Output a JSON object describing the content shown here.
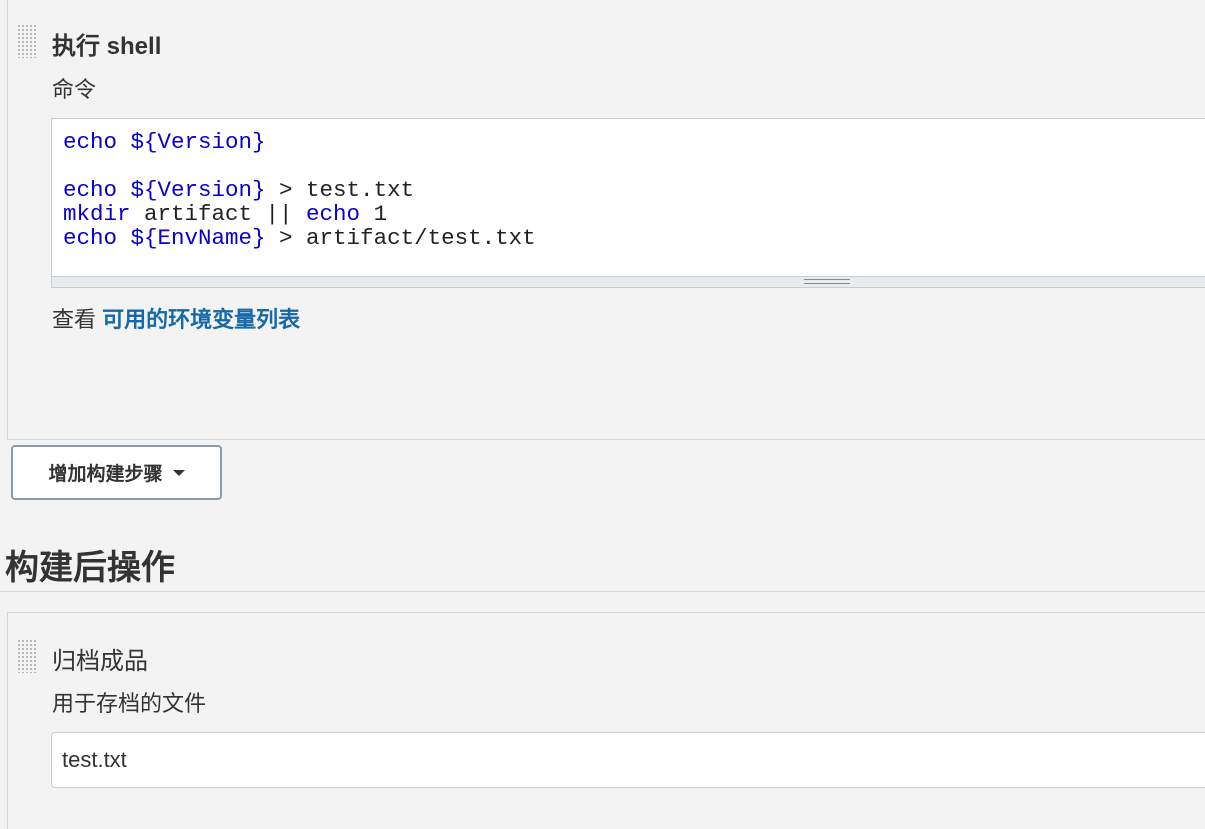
{
  "build_step": {
    "title": "执行 shell",
    "command_label": "命令",
    "command_lines": [
      [
        {
          "t": "echo ${Version}",
          "kw": true
        }
      ],
      [],
      [
        {
          "t": "echo ${Version}",
          "kw": true
        },
        {
          "t": " > test.txt",
          "kw": false
        }
      ],
      [
        {
          "t": "mkdir",
          "kw": true
        },
        {
          "t": " artifact || ",
          "kw": false
        },
        {
          "t": "echo",
          "kw": true
        },
        {
          "t": " 1",
          "kw": false
        }
      ],
      [
        {
          "t": "echo ${EnvName}",
          "kw": true
        },
        {
          "t": " > artifact/test.txt",
          "kw": false
        }
      ]
    ],
    "help_prefix": "查看",
    "help_link": "可用的环境变量列表"
  },
  "add_step_button": {
    "label": "增加构建步骤",
    "icon": "caret-down-icon"
  },
  "post_build": {
    "section_title": "构建后操作",
    "step_title": "归档成品",
    "files_label": "用于存档的文件",
    "files_value": "test.txt"
  },
  "colors": {
    "keyword": "#0a00c8",
    "link": "#1669a8",
    "background": "#f3f3f3"
  }
}
